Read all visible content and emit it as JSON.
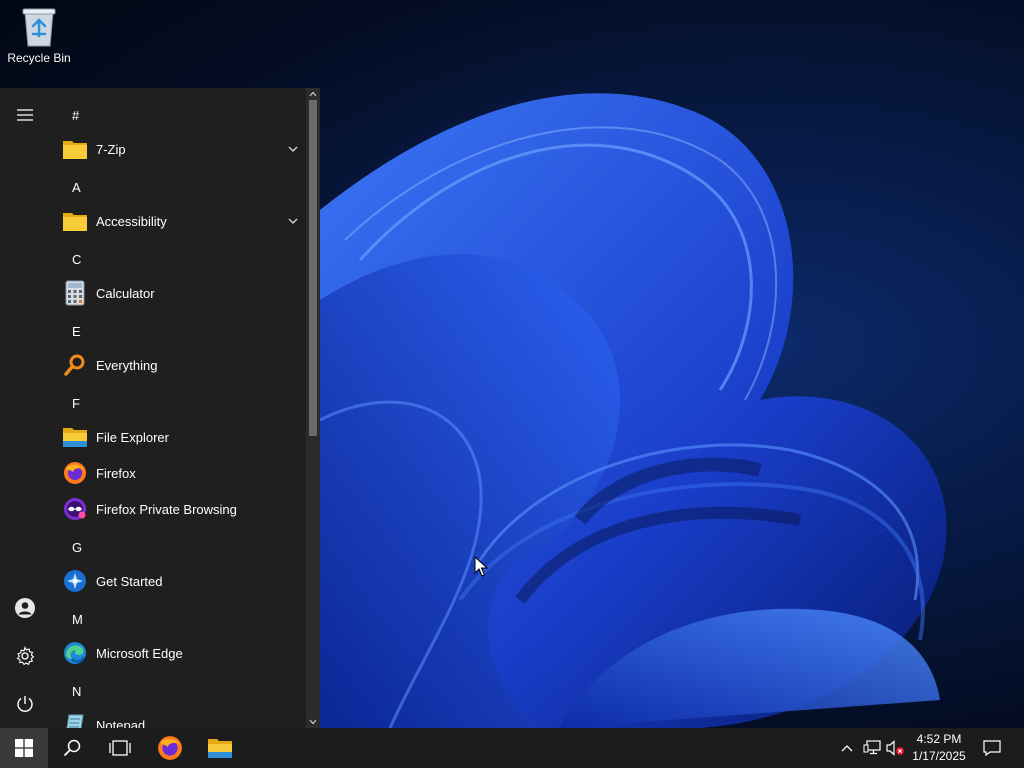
{
  "desktop": {
    "icons": [
      {
        "label": "Recycle Bin",
        "icon": "recycle-bin-icon"
      }
    ]
  },
  "start_menu": {
    "rail": {
      "menu": "hamburger-icon",
      "user": "user-icon",
      "settings": "gear-icon",
      "power": "power-icon"
    },
    "headers": [
      "#",
      "A",
      "C",
      "E",
      "F",
      "G",
      "M",
      "N"
    ],
    "apps": [
      {
        "label": "7-Zip",
        "icon": "folder-icon",
        "expandable": true
      },
      {
        "label": "Accessibility",
        "icon": "folder-icon",
        "expandable": true
      },
      {
        "label": "Calculator",
        "icon": "calculator-icon"
      },
      {
        "label": "Everything",
        "icon": "search-magnifier-icon"
      },
      {
        "label": "File Explorer",
        "icon": "file-explorer-icon"
      },
      {
        "label": "Firefox",
        "icon": "firefox-icon"
      },
      {
        "label": "Firefox Private Browsing",
        "icon": "firefox-private-icon"
      },
      {
        "label": "Get Started",
        "icon": "get-started-icon"
      },
      {
        "label": "Microsoft Edge",
        "icon": "edge-icon"
      },
      {
        "label": "Notepad",
        "icon": "notepad-icon"
      }
    ]
  },
  "taskbar": {
    "items": [
      "windows-start-icon",
      "search-icon",
      "task-view-icon",
      "firefox-icon",
      "file-explorer-icon"
    ],
    "tray": [
      "chevron-up-icon",
      "network-icon",
      "volume-muted-icon",
      "notifications-icon"
    ],
    "clock": {
      "time": "4:52 PM",
      "date": "1/17/2025"
    }
  },
  "colors": {
    "menu_bg": "#1f1f1f",
    "taskbar_bg": "#1c1c1c",
    "folder": "#f5c518",
    "wallpaper_blue": "#1a4fd8"
  }
}
